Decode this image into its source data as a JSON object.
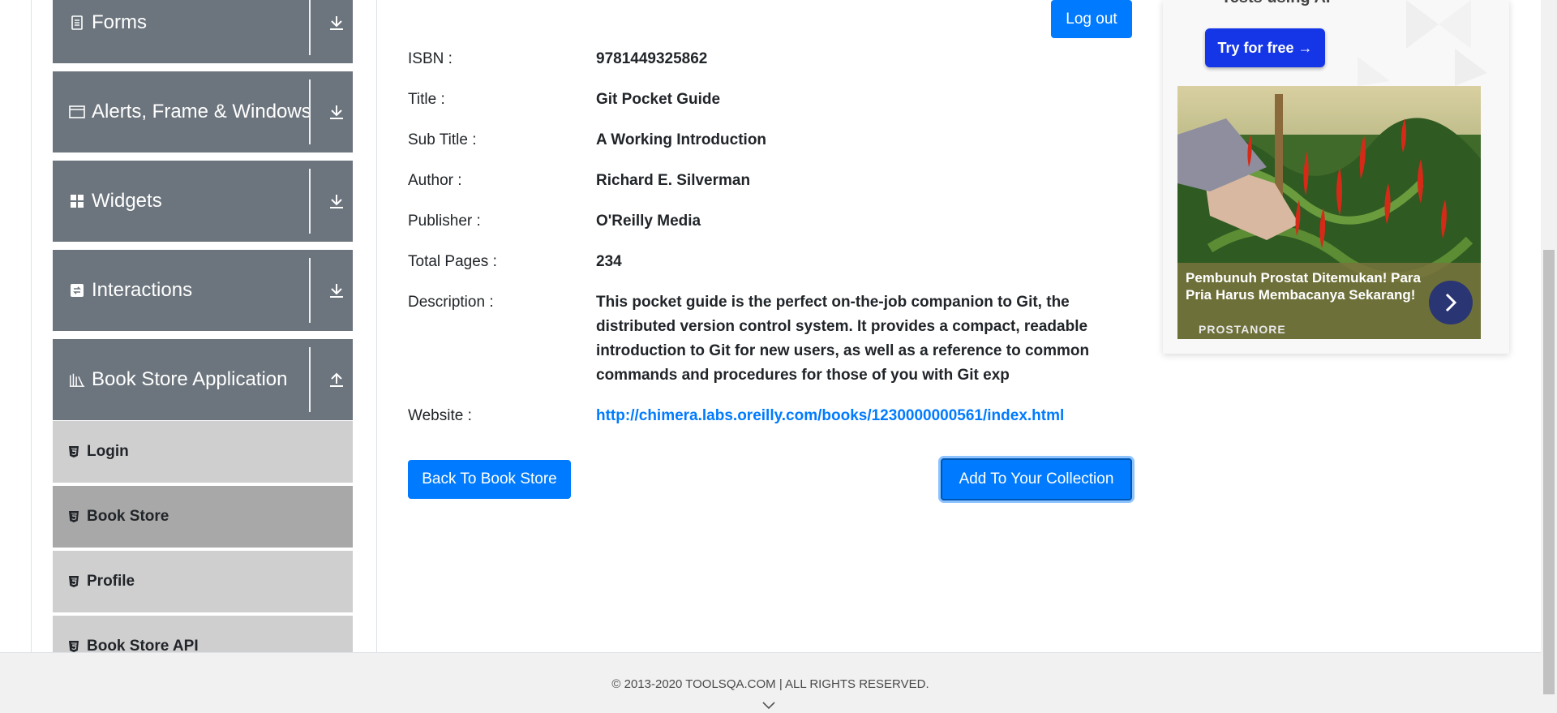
{
  "sidebar": {
    "groups": [
      {
        "label": "Forms",
        "icon": "document-icon",
        "arrow": "download-arrow-icon"
      },
      {
        "label": "Alerts, Frame & Windows",
        "icon": "window-icon",
        "arrow": "download-arrow-icon"
      },
      {
        "label": "Widgets",
        "icon": "widgets-icon",
        "arrow": "download-arrow-icon"
      },
      {
        "label": "Interactions",
        "icon": "interactions-icon",
        "arrow": "download-arrow-icon"
      },
      {
        "label": "Book Store Application",
        "icon": "books-icon",
        "arrow": "upload-arrow-icon"
      }
    ],
    "items": [
      {
        "label": "Login",
        "active": false
      },
      {
        "label": "Book Store",
        "active": true
      },
      {
        "label": "Profile",
        "active": false
      },
      {
        "label": "Book Store API",
        "active": false
      }
    ]
  },
  "header": {
    "logout_label": "Log out"
  },
  "book": {
    "fields": [
      {
        "label": "ISBN :",
        "value": "9781449325862"
      },
      {
        "label": "Title :",
        "value": "Git Pocket Guide"
      },
      {
        "label": "Sub Title :",
        "value": "A Working Introduction"
      },
      {
        "label": "Author :",
        "value": "Richard E. Silverman"
      },
      {
        "label": "Publisher :",
        "value": "O'Reilly Media"
      },
      {
        "label": "Total Pages :",
        "value": "234"
      },
      {
        "label": "Description :",
        "value": "This pocket guide is the perfect on-the-job companion to Git, the distributed version control system. It provides a compact, readable introduction to Git for new users, as well as a reference to common commands and procedures for those of you with Git exp"
      },
      {
        "label": "Website :",
        "value": "http://chimera.labs.oreilly.com/books/1230000000561/index.html"
      }
    ]
  },
  "actions": {
    "back_label": "Back To Book Store",
    "add_label": "Add To Your Collection"
  },
  "ad": {
    "top_text": "Tests using AI",
    "try_label": "Try for free →",
    "caption": "Pembunuh Prostat Ditemukan! Para Pria Harus Membacanya Sekarang!",
    "brand": "PROSTANORE"
  },
  "footer": {
    "text": "© 2013-2020 TOOLSQA.COM | ALL RIGHTS RESERVED."
  },
  "colors": {
    "primary": "#007bff",
    "sidebar_group": "#6c757d",
    "sidebar_item": "#cfcfcf",
    "sidebar_active": "#a8a8a8",
    "ad_button": "#1436e6"
  }
}
